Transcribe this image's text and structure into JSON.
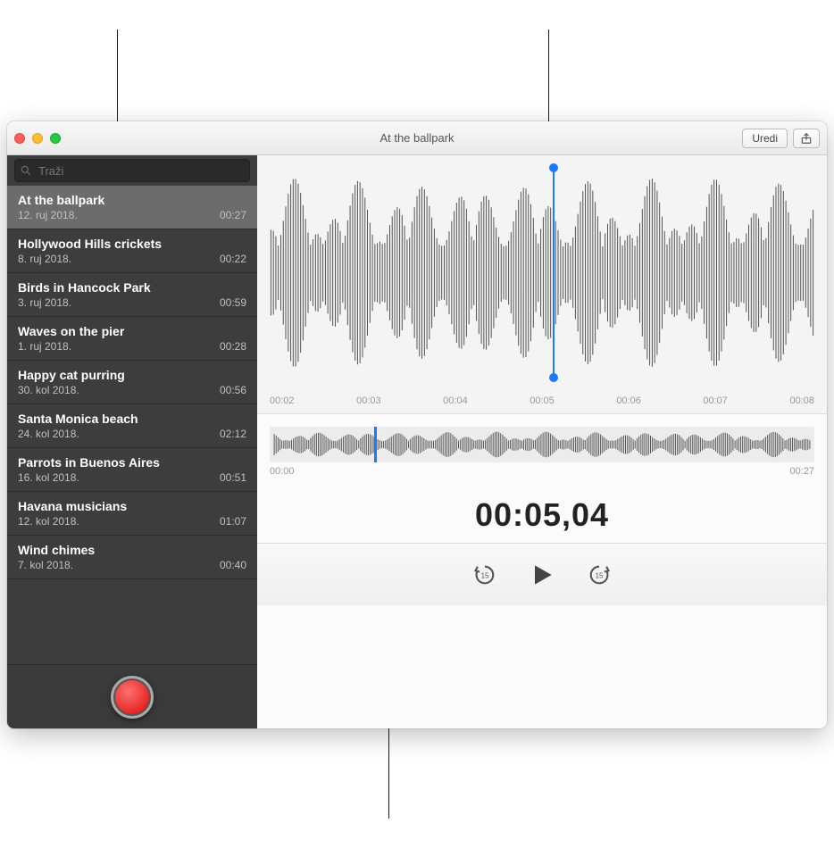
{
  "header": {
    "title": "At the ballpark",
    "edit_label": "Uredi"
  },
  "search": {
    "placeholder": "Traži"
  },
  "recordings": [
    {
      "title": "At the ballpark",
      "date": "12. ruj 2018.",
      "duration": "00:27",
      "selected": true
    },
    {
      "title": "Hollywood Hills crickets",
      "date": "8. ruj 2018.",
      "duration": "00:22"
    },
    {
      "title": "Birds in Hancock Park",
      "date": "3. ruj 2018.",
      "duration": "00:59"
    },
    {
      "title": "Waves on the pier",
      "date": "1. ruj 2018.",
      "duration": "00:28"
    },
    {
      "title": "Happy cat purring",
      "date": "30. kol 2018.",
      "duration": "00:56"
    },
    {
      "title": "Santa Monica beach",
      "date": "24. kol 2018.",
      "duration": "02:12"
    },
    {
      "title": "Parrots in Buenos Aires",
      "date": "16. kol 2018.",
      "duration": "00:51"
    },
    {
      "title": "Havana musicians",
      "date": "12. kol 2018.",
      "duration": "01:07"
    },
    {
      "title": "Wind chimes",
      "date": "7. kol 2018.",
      "duration": "00:40"
    }
  ],
  "ticks": [
    "00:02",
    "00:03",
    "00:04",
    "00:05",
    "00:06",
    "00:07",
    "00:08"
  ],
  "overview": {
    "start": "00:00",
    "end": "00:27"
  },
  "timecode": "00:05,04",
  "skip_seconds": "15"
}
